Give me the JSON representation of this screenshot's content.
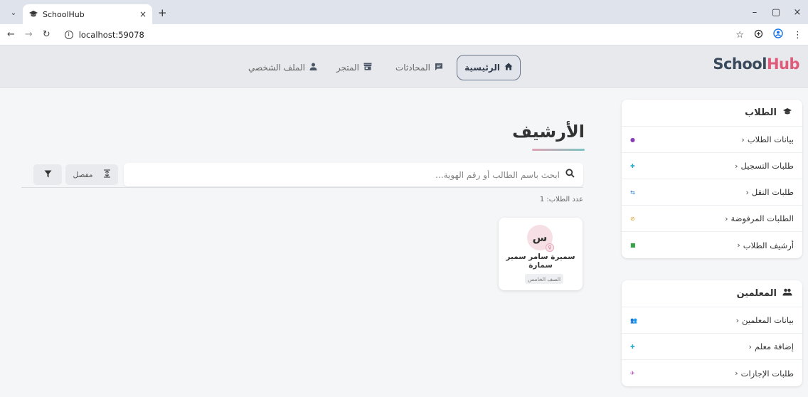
{
  "browser": {
    "tab_title": "SchoolHub",
    "tab_close": "×",
    "new_tab": "+",
    "url": "localhost:59078",
    "window_controls": [
      "–",
      "▢",
      "×"
    ],
    "icons": [
      "star-icon",
      "extensions-icon",
      "profile-icon",
      "menu-icon"
    ]
  },
  "header": {
    "brand_school": "School",
    "brand_hub": "Hub",
    "nav": [
      {
        "label": "الرئيسية",
        "icon": "home-icon"
      },
      {
        "label": "المحادثات",
        "icon": "chat-icon"
      },
      {
        "label": "المتجر",
        "icon": "store-icon"
      },
      {
        "label": "الملف الشخصي",
        "icon": "person-icon"
      }
    ]
  },
  "sidebar": {
    "students": {
      "title": "الطلاب",
      "items": [
        {
          "label": "بيانات الطلاب",
          "color": "#8a3fb5"
        },
        {
          "label": "طلبات التسجيل",
          "color": "#2aa8c9"
        },
        {
          "label": "طلبات النقل",
          "color": "#2a7bc9"
        },
        {
          "label": "الطلبات المرفوضة",
          "color": "#e0a030"
        },
        {
          "label": "أرشيف الطلاب",
          "color": "#3aa14a"
        }
      ]
    },
    "teachers": {
      "title": "المعلمين",
      "items": [
        {
          "label": "بيانات المعلمين",
          "color": "#2aa8c9"
        },
        {
          "label": "إضافة معلم",
          "color": "#2aa8c9"
        },
        {
          "label": "طلبات الإجازات",
          "color": "#b03fb5"
        }
      ]
    }
  },
  "main": {
    "title": "الأرشيف",
    "search_placeholder": "ابحث باسم الطالب أو رقم الهوية...",
    "detail_label": "مفصل",
    "count_label": "عدد الطلاب: 1",
    "students": [
      {
        "initial": "س",
        "name": "سميرة سامر سمير سمارة",
        "grade": "الصف الخامس",
        "badge": "♀"
      }
    ]
  }
}
